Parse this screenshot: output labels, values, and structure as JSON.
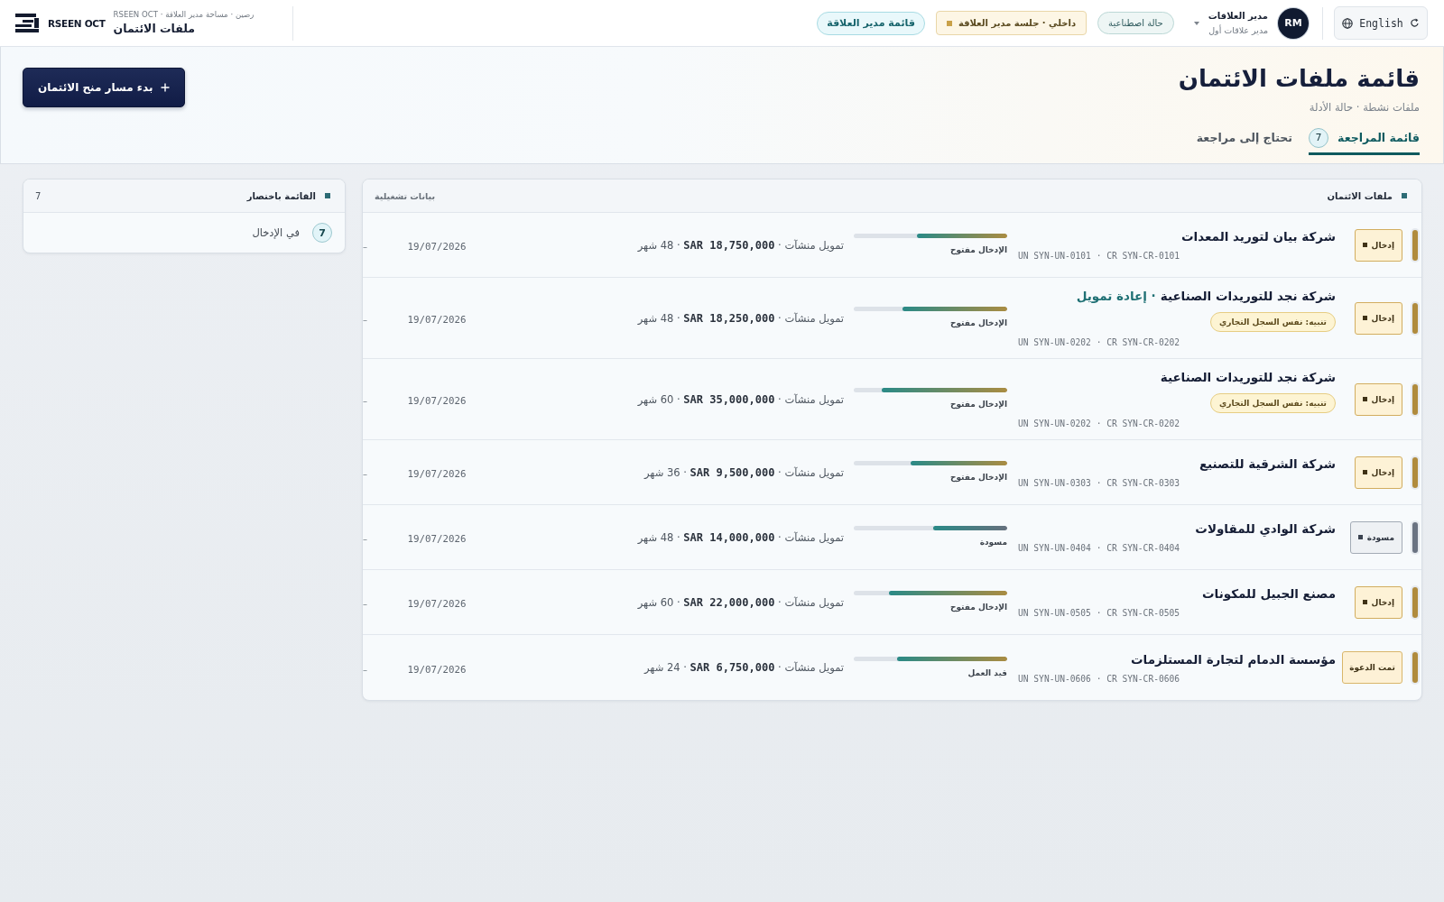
{
  "top_bar": {
    "logo_text": "RSEEN OCT",
    "breadcrumb": "رصين · مساحة مدير العلاقة · RSEEN OCT",
    "page_title": "ملفات الائتمان",
    "pills": [
      {
        "label": "حالة اصطناعية",
        "kind": "synthetic"
      },
      {
        "label": "داخلي · جلسة مدير العلاقة",
        "kind": "session"
      },
      {
        "label": "قائمة مدير العلاقة",
        "kind": "queue"
      }
    ],
    "user": {
      "name": "مدير العلاقات",
      "role": "مدير علاقات أول",
      "initials": "RM"
    },
    "language_button": "English"
  },
  "header": {
    "title": "قائمة ملفات الائتمان",
    "subtitle": "ملفات نشطة · حالة الأدلة",
    "tabs": [
      {
        "label": "قائمة المراجعة",
        "count": "7",
        "selected": true
      },
      {
        "label": "تحتاج إلى مراجعة",
        "selected": false
      }
    ],
    "primary_button": "بدء مسار منح الائتمان"
  },
  "files_panel": {
    "title": "ملفات الائتمان",
    "note": "بيانات تشغيلية",
    "rows": [
      {
        "status": {
          "label": "إدخال",
          "kind": "intake"
        },
        "name": "شركة بيان لتوريد المعدات",
        "ids": "UN SYN-UN-0101 · CR SYN-CR-0101",
        "level": 0.59,
        "stage": "الإدخال مفتوح",
        "amount": "تمويل منشآت · **SAR 18,750,000** · 48 شهر",
        "date": "19/07/2026",
        "cut_off_text": "–"
      },
      {
        "status": {
          "label": "إدخال",
          "kind": "intake"
        },
        "name": "شركة نجد للتوريدات الصناعية",
        "chain": "· إعادة تمويل",
        "warning": "تنبيه: نفس السجل التجاري",
        "ids": "UN SYN-UN-0202 · CR SYN-CR-0202",
        "level": 0.68,
        "stage": "الإدخال مفتوح",
        "amount": "تمويل منشآت · **SAR 18,250,000** · 48 شهر",
        "date": "19/07/2026",
        "cut_off_text": "–"
      },
      {
        "status": {
          "label": "إدخال",
          "kind": "intake"
        },
        "name": "شركة نجد للتوريدات الصناعية",
        "warning": "تنبيه: نفس السجل التجاري",
        "ids": "UN SYN-UN-0202 · CR SYN-CR-0202",
        "level": 0.82,
        "stage": "الإدخال مفتوح",
        "amount": "تمويل منشآت · **SAR 35,000,000** · 60 شهر",
        "date": "19/07/2026",
        "cut_off_text": "–"
      },
      {
        "status": {
          "label": "إدخال",
          "kind": "intake"
        },
        "name": "شركة الشرقية للتصنيع",
        "ids": "UN SYN-UN-0303 · CR SYN-CR-0303",
        "level": 0.63,
        "stage": "الإدخال مفتوح",
        "amount": "تمويل منشآت · **SAR 9,500,000** · 36 شهر",
        "date": "19/07/2026",
        "cut_off_text": "–"
      },
      {
        "status": {
          "label": "مسودة",
          "kind": "draft"
        },
        "name": "شركة الوادي للمقاولات",
        "ids": "UN SYN-UN-0404 · CR SYN-CR-0404",
        "level": 0.48,
        "stage": "مسودة",
        "amount": "تمويل منشآت · **SAR 14,000,000** · 48 شهر",
        "date": "19/07/2026",
        "cut_off_text": "–"
      },
      {
        "status": {
          "label": "إدخال",
          "kind": "intake"
        },
        "name": "مصنع الجبيل للمكونات",
        "ids": "UN SYN-UN-0505 · CR SYN-CR-0505",
        "level": 0.77,
        "stage": "الإدخال مفتوح",
        "amount": "تمويل منشآت · **SAR 22,000,000** · 60 شهر",
        "date": "19/07/2026",
        "cut_off_text": "–"
      },
      {
        "status": {
          "label": "تمت الدعوة",
          "kind": "invited"
        },
        "name": "مؤسسة الدمام لتجارة المستلزمات",
        "ids": "UN SYN-UN-0606 · CR SYN-CR-0606",
        "level": 0.72,
        "stage": "قيد العمل",
        "amount": "تمويل منشآت · **SAR 6,750,000** · 24 شهر",
        "date": "19/07/2026",
        "cut_off_text": "–"
      }
    ]
  },
  "summary_panel": {
    "title": "القائمة باختصار",
    "total": "7",
    "items": [
      {
        "count": "7",
        "label": "في الإدخال"
      }
    ]
  }
}
